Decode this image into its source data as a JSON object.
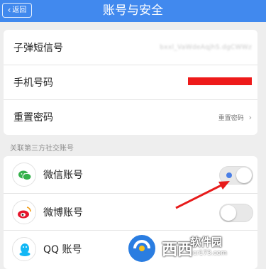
{
  "header": {
    "back_label": "返回",
    "title": "账号与安全",
    "color": "#4189ee"
  },
  "account": {
    "rows": [
      {
        "label": "子弹短信号",
        "value": "bxxl_VaWdeAqjhS.dgCWWz"
      },
      {
        "label": "手机号码",
        "value": ""
      },
      {
        "label": "重置密码",
        "value": "重置密码"
      }
    ]
  },
  "social": {
    "section_label": "关联第三方社交账号",
    "items": [
      {
        "label": "微信账号",
        "icon": "wechat-icon",
        "toggle_on": false
      },
      {
        "label": "微博账号",
        "icon": "weibo-icon",
        "toggle_on": false
      },
      {
        "label": "QQ 账号",
        "icon": "qq-icon",
        "toggle_on": false
      }
    ]
  },
  "watermark": {
    "text_main": "西西",
    "text_site": "软件园",
    "text_url": "cr173.com"
  }
}
